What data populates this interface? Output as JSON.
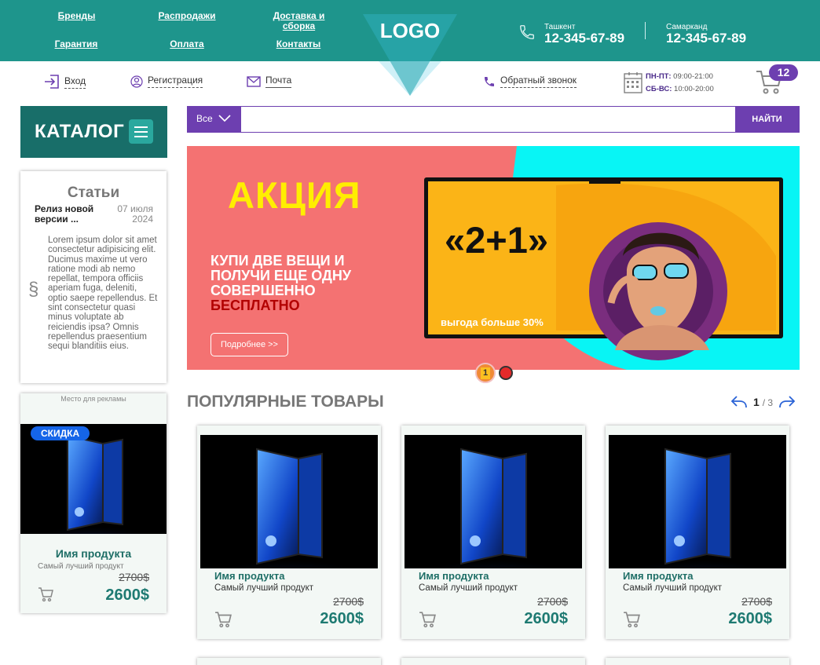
{
  "header": {
    "nav": [
      "Бренды",
      "Распродажи",
      "Доставка и сборка",
      "Гарантия",
      "Оплата",
      "Контакты"
    ],
    "logo": "LOGO",
    "phones": [
      {
        "city": "Ташкент",
        "number": "12-345-67-89"
      },
      {
        "city": "Самарканд",
        "number": "12-345-67-89"
      }
    ]
  },
  "subbar": {
    "login": "Вход",
    "register": "Регистрация",
    "mail": "Почта",
    "callback": "Обратный звонок",
    "hours_weekdays_label": "ПН-ПТ:",
    "hours_weekdays": "09:00-21:00",
    "hours_weekend_label": "СБ-ВС:",
    "hours_weekend": "10:00-20:00",
    "cart_count": "12"
  },
  "catalog": {
    "label": "КАТАЛОГ"
  },
  "articles": {
    "title": "Статьи",
    "headline": "Релиз новой версии ...",
    "date": "07 июля 2024",
    "body": "Lorem ipsum dolor sit amet consectetur adipisicing elit. Ducimus maxime ut vero ratione modi ab nemo repellat, tempora officiis aperiam fuga, deleniti, optio saepe repellendus. Et sint consectetur quasi minus voluptate ab reiciendis ipsa? Omnis repellendus praesentium sequi blanditiis eius.",
    "symbol": "§"
  },
  "ad": {
    "caption": "Место для рекламы",
    "badge": "СКИДКА",
    "name": "Имя продукта",
    "desc": "Самый лучший продукт",
    "old_price": "2700$",
    "new_price": "2600$"
  },
  "search": {
    "category": "Все",
    "placeholder": "",
    "button": "НАЙТИ"
  },
  "banner": {
    "title": "АКЦИЯ",
    "text_line1": "КУПИ ДВЕ ВЕЩИ И ПОЛУЧИ ЕЩЕ ОДНУ СОВЕРШЕННО",
    "text_line2": "БЕСПЛАТНО",
    "button": "Подробнее >>",
    "promo": "«2+1»",
    "benefit": "выгода больше 30%",
    "active_slide": "1"
  },
  "popular": {
    "title": "ПОПУЛЯРНЫЕ ТОВАРЫ",
    "page": "1",
    "total": "/ 3",
    "products": [
      {
        "name": "Имя продукта",
        "desc": "Самый лучший продукт",
        "old_price": "2700$",
        "new_price": "2600$"
      },
      {
        "name": "Имя продукта",
        "desc": "Самый лучший продукт",
        "old_price": "2700$",
        "new_price": "2600$"
      },
      {
        "name": "Имя продукта",
        "desc": "Самый лучший продукт",
        "old_price": "2700$",
        "new_price": "2600$"
      }
    ]
  },
  "colors": {
    "header": "#1e958c",
    "accent": "#6d3fb0",
    "catalog": "#186e69",
    "banner_bg": "#f47272",
    "banner_title": "#ffee00",
    "price": "#1e7a72"
  }
}
